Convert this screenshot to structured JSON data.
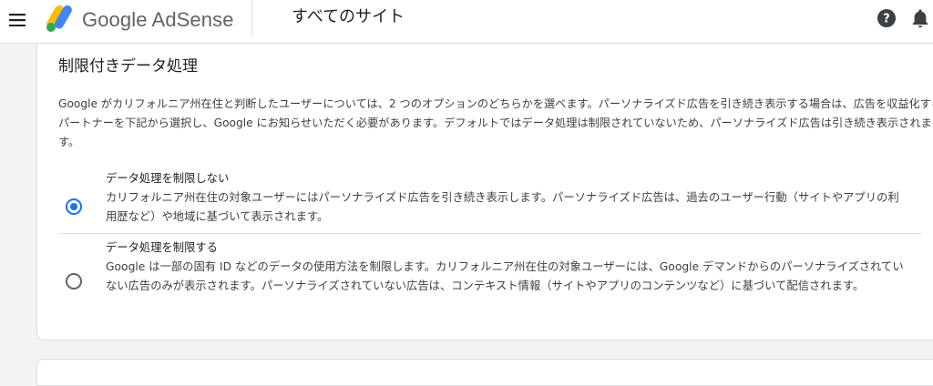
{
  "header": {
    "app_name": "Google AdSense",
    "page_title": "すべてのサイト",
    "icons": {
      "menu": "hamburger-menu-icon",
      "logo": "adsense-logo-icon",
      "help": "help-icon",
      "notifications": "bell-icon"
    }
  },
  "section": {
    "title": "制限付きデータ処理",
    "description": "Google がカリフォルニア州在住と判断したユーザーについては、2 つのオプションのどちらかを選べます。パーソナライズド広告を引き続き表示する場合は、広告を収益化するパートナーを下記から選択し、Google にお知らせいただく必要があります。デフォルトではデータ処理は制限されていないため、パーソナライズド広告は引き続き表示されます。",
    "options": [
      {
        "title": "データ処理を制限しない",
        "body": "カリフォルニア州在住の対象ユーザーにはパーソナライズド広告を引き続き表示します。パーソナライズド広告は、過去のユーザー行動（サイトやアプリの利用歴など）や地域に基づいて表示されます。",
        "selected": true
      },
      {
        "title": "データ処理を制限する",
        "body": "Google は一部の固有 ID などのデータの使用方法を制限します。カリフォルニア州在住の対象ユーザーには、Google デマンドからのパーソナライズされていない広告のみが表示されます。パーソナライズされていない広告は、コンテキスト情報（サイトやアプリのコンテンツなど）に基づいて配信されます。",
        "selected": false
      }
    ]
  },
  "colors": {
    "accent": "#1a73e8",
    "logo_yellow": "#fbbc04",
    "logo_blue": "#4285f4",
    "logo_green": "#34a853"
  }
}
